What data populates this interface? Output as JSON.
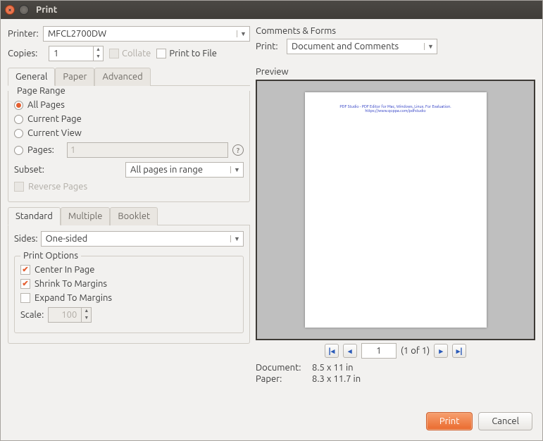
{
  "title": "Print",
  "printer": {
    "label": "Printer:",
    "value": "MFCL2700DW"
  },
  "copies": {
    "label": "Copies:",
    "value": "1"
  },
  "collate": {
    "label": "Collate"
  },
  "print_to_file": {
    "label": "Print to File"
  },
  "tabs_main": {
    "general": "General",
    "paper": "Paper",
    "advanced": "Advanced"
  },
  "page_range": {
    "legend": "Page Range",
    "all": "All Pages",
    "current_page": "Current Page",
    "current_view": "Current View",
    "pages": "Pages:",
    "pages_value": "1",
    "subset_label": "Subset:",
    "subset_value": "All pages in range",
    "reverse": "Reverse Pages"
  },
  "tabs_layout": {
    "standard": "Standard",
    "multiple": "Multiple",
    "booklet": "Booklet"
  },
  "sides": {
    "label": "Sides:",
    "value": "One-sided"
  },
  "print_options": {
    "legend": "Print Options",
    "center": "Center In Page",
    "shrink": "Shrink To Margins",
    "expand": "Expand To Margins",
    "scale_label": "Scale:",
    "scale_value": "100"
  },
  "comments_forms": {
    "heading": "Comments & Forms",
    "print_label": "Print:",
    "print_value": "Document and Comments"
  },
  "preview": {
    "heading": "Preview",
    "page_text": "PDF Studio - PDF Editor for Mac, Windows, Linux. For Evaluation. https://www.qoppa.com/pdfstudio",
    "page_input": "1",
    "page_count": "(1 of 1)",
    "doc_label": "Document:",
    "doc_value": "8.5 x 11 in",
    "paper_label": "Paper:",
    "paper_value": "8.3 x 11.7 in"
  },
  "buttons": {
    "print": "Print",
    "cancel": "Cancel"
  }
}
